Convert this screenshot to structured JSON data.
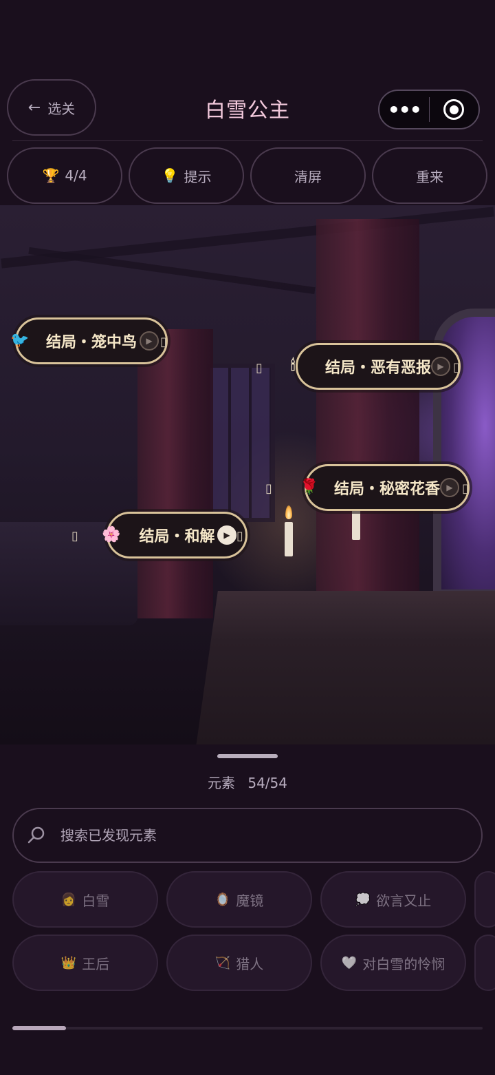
{
  "header": {
    "back_label": "选关",
    "title": "白雪公主",
    "capsule": {
      "more_icon": "•••",
      "target_icon": "target-icon"
    }
  },
  "toolbar": {
    "progress": "4/4",
    "hint": "提示",
    "clear": "清屏",
    "restart": "重来"
  },
  "scene": {
    "endings": [
      {
        "label": "结局・笼中鸟",
        "emoji": "🐦"
      },
      {
        "label": "结局・恶有恶报",
        "emoji": "🕯"
      },
      {
        "label": "结局・秘密花香",
        "emoji": "🌹"
      },
      {
        "label": "结局・和解",
        "emoji": "🌸"
      }
    ],
    "placeholder_glyph": "▯"
  },
  "panel": {
    "elements_label": "元素",
    "elements_count": "54/54",
    "search_placeholder": "搜索已发现元素",
    "chips": [
      {
        "label": "白雪",
        "icon": "👩"
      },
      {
        "label": "魔镜",
        "icon": "🪞"
      },
      {
        "label": "欲言又止",
        "icon": "💭"
      },
      {
        "label": "王后",
        "icon": "👑"
      },
      {
        "label": "猎人",
        "icon": "🏹"
      },
      {
        "label": "对白雪的怜悯",
        "icon": "🤍"
      }
    ]
  },
  "colors": {
    "background": "#1a0f1d",
    "title": "#f3c9dc",
    "ending_border": "#d9c39a",
    "ending_text": "#f5e7c8"
  }
}
